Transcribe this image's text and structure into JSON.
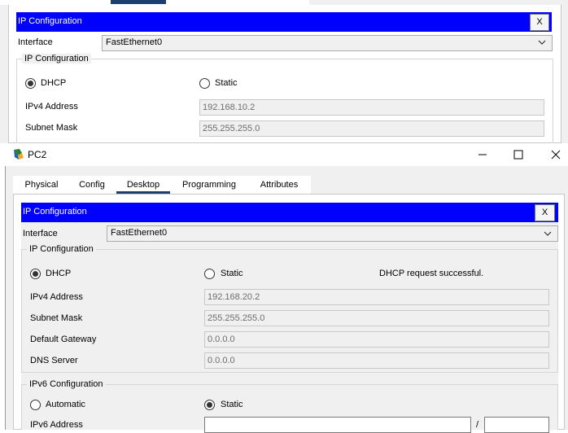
{
  "background_window": {
    "ip_config_title": "IP Configuration",
    "close_label": "X",
    "interface_label": "Interface",
    "interface_value": "FastEthernet0",
    "ip_group_legend": "IP Configuration",
    "dhcp_label": "DHCP",
    "static_label": "Static",
    "ipv4_label": "IPv4 Address",
    "ipv4_value": "192.168.10.2",
    "mask_label": "Subnet Mask",
    "mask_value": "255.255.255.0",
    "mode": "DHCP"
  },
  "window": {
    "title": "PC2",
    "tabs": [
      {
        "label": "Physical"
      },
      {
        "label": "Config"
      },
      {
        "label": "Desktop",
        "active": true
      },
      {
        "label": "Programming"
      },
      {
        "label": "Attributes"
      }
    ]
  },
  "ip_config": {
    "title": "IP Configuration",
    "close_label": "X",
    "interface_label": "Interface",
    "interface_value": "FastEthernet0",
    "ip_group_legend": "IP Configuration",
    "dhcp_label": "DHCP",
    "static_label": "Static",
    "status_message": "DHCP request successful.",
    "mode": "DHCP",
    "fields": {
      "ipv4_label": "IPv4 Address",
      "ipv4_value": "192.168.20.2",
      "mask_label": "Subnet Mask",
      "mask_value": "255.255.255.0",
      "gateway_label": "Default Gateway",
      "gateway_value": "0.0.0.0",
      "dns_label": "DNS Server",
      "dns_value": "0.0.0.0"
    },
    "ipv6": {
      "legend": "IPv6 Configuration",
      "automatic_label": "Automatic",
      "static_label": "Static",
      "mode": "Static",
      "address_label": "IPv6 Address",
      "address_value": "",
      "prefix_separator": "/",
      "prefix_value": ""
    }
  },
  "colors": {
    "title_bar_blue": "#0000ff",
    "active_tab_underline": "#1d3f6e"
  }
}
